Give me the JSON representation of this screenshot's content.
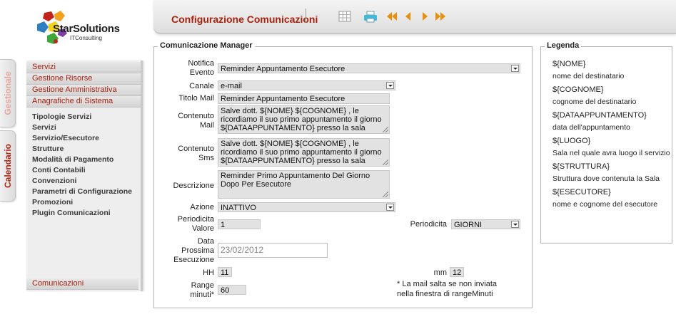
{
  "side_tabs": [
    "Gestionale",
    "Calendario"
  ],
  "logo": {
    "name": "StarSolutions",
    "tagline": "ITConsulting"
  },
  "menu": {
    "top_items": [
      "Servizi",
      "Gestione Risorse",
      "Gestione Amministrativa",
      "Anagrafiche di Sistema"
    ],
    "sub_items": [
      "Tipologie Servizi",
      "Servizi",
      "Servizio/Esecutore",
      "Strutture",
      "Modalità di Pagamento",
      "Conti Contabili",
      "Convenzioni",
      "Parametri di Configurazione",
      "Promozioni",
      "Plugin Comunicazioni"
    ],
    "bottom_item": "Comunicazioni"
  },
  "header": {
    "title": "Configurazione Comunicazioni",
    "toolbar_icons": [
      "grid-icon",
      "print-icon",
      "first-icon",
      "prev-icon",
      "next-icon",
      "last-icon"
    ]
  },
  "form": {
    "legend": "Comunicazione Manager",
    "notifica_label": "Notifica Evento",
    "notifica_value": "Reminder Appuntamento Esecutore",
    "canale_label": "Canale",
    "canale_value": "e-mail",
    "titolo_label": "Titolo Mail",
    "titolo_value": "Reminder Appuntamento Esecutore",
    "contenuto_mail_label": "Contenuto Mail",
    "contenuto_mail_value": "Salve dott. ${NOME} ${COGNOME} , le ricordiamo il suo primo appuntamento il giorno ${DATAAPPUNTAMENTO} presso la sala ${LUOGO} della struttura",
    "contenuto_sms_label": "Contenuto Sms",
    "contenuto_sms_value": "Salve dott. ${NOME} ${COGNOME} , le ricordiamo il suo primo appuntamento il giorno ${DATAAPPUNTAMENTO} presso la sala ${LUOGO} della struttura",
    "descrizione_label": "Descrizione",
    "descrizione_value": "Reminder Primo Appuntamento Del Giorno Dopo Per Esecutore",
    "azione_label": "Azione",
    "azione_value": "INATTIVO",
    "periodicita_valore_label": "Periodicita Valore",
    "periodicita_valore_value": "1",
    "periodicita_label": "Periodicita",
    "periodicita_value": "GIORNI",
    "data_label": "Data Prossima Esecuzione",
    "data_value": "23/02/2012",
    "hh_label": "HH",
    "hh_value": "11",
    "mm_label": "mm",
    "mm_value": "12",
    "range_label": "Range minuti*",
    "range_value": "60",
    "note": "* La mail salta se non inviata nella finestra di rangeMinuti"
  },
  "legenda": {
    "title": "Legenda",
    "items": [
      {
        "var": "${NOME}",
        "desc": "nome del destinatario"
      },
      {
        "var": "${COGNOME}",
        "desc": "cognome del destinatario"
      },
      {
        "var": "${DATAAPPUNTAMENTO}",
        "desc": "data dell'appuntamento"
      },
      {
        "var": "${LUOGO}",
        "desc": "Sala nel quale avra luogo il servizio"
      },
      {
        "var": "${STRUTTURA}",
        "desc": "Struttura dove contenuta la Sala"
      },
      {
        "var": "${ESECUTORE}",
        "desc": "nome e cognome del esecutore"
      }
    ]
  },
  "colors": {
    "accent": "#a8200e",
    "toolbar_arrows": "#e8900c",
    "print_icon": "#41b9d8"
  }
}
